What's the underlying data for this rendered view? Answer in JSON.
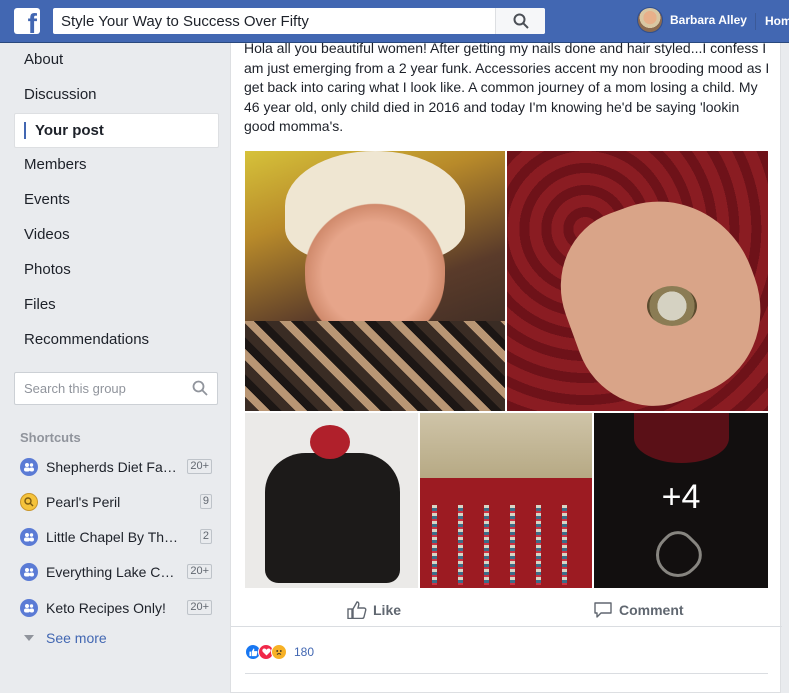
{
  "header": {
    "search_value": "Style Your Way to Success Over Fifty",
    "user_name": "Barbara Alley",
    "home_label": "Home",
    "brand_color": "#4267b2"
  },
  "sidebar": {
    "items": [
      {
        "label": "About"
      },
      {
        "label": "Discussion"
      },
      {
        "label": "Your post",
        "active": true
      },
      {
        "label": "Members"
      },
      {
        "label": "Events"
      },
      {
        "label": "Videos"
      },
      {
        "label": "Photos"
      },
      {
        "label": "Files"
      },
      {
        "label": "Recommendations"
      }
    ],
    "search_placeholder": "Search this group",
    "shortcuts_title": "Shortcuts",
    "shortcuts": [
      {
        "label": "Shepherds Diet Fa…",
        "count": "20+",
        "icon": "group-icon"
      },
      {
        "label": "Pearl's Peril",
        "count": "9",
        "icon": "game-icon"
      },
      {
        "label": "Little Chapel By The …",
        "count": "2",
        "icon": "group-icon"
      },
      {
        "label": "Everything Lake C…",
        "count": "20+",
        "icon": "group-icon"
      },
      {
        "label": "Keto Recipes Only!",
        "count": "20+",
        "icon": "group-icon"
      }
    ],
    "see_more": "See more"
  },
  "post": {
    "text": "Hola all you beautiful women! After getting my nails done and hair styled...I confess I am just emerging from a 2 year funk. Accessories accent my non brooding mood as I get back into caring what I look like. A common journey of a mom losing a child. My 46 year old, only child died in 2016 and today I'm knowing he'd be saying 'lookin good momma's.",
    "more_photos": "+4",
    "like_label": "Like",
    "comment_label": "Comment",
    "reaction_count": "180"
  }
}
